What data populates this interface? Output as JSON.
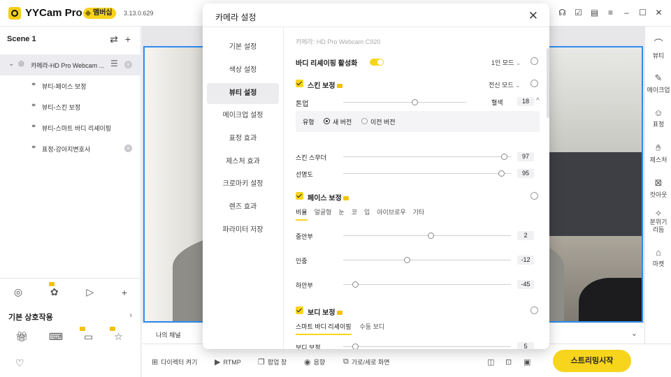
{
  "titlebar": {
    "app_name": "YYCam Pro",
    "member_badge": "멤버십",
    "version": "3.13.0.629",
    "icons": [
      "headset-icon",
      "feedback-icon",
      "doc-icon",
      "menu-icon",
      "minimize-icon",
      "maximize-icon",
      "close-icon"
    ]
  },
  "left_panel": {
    "scene_title": "Scene 1",
    "sources": [
      {
        "label": "카메라-HD Pro Webcam ...",
        "icon": "camera-icon"
      },
      {
        "label": "뷰티-페이스 보정",
        "icon": "link-icon"
      },
      {
        "label": "뷰티-스킨 보정",
        "icon": "link-icon"
      },
      {
        "label": "뷰티-스마트 바디 리셰이핑",
        "icon": "link-icon"
      },
      {
        "label": "표정-강아지변호사",
        "icon": "link-icon"
      }
    ],
    "interaction_title": "기본 상호작용"
  },
  "preview": {
    "channel_label": "나의 채널"
  },
  "toolbar": {
    "director": "다이렉터 켜기",
    "rtmp": "RTMP",
    "popup": "팝업 창",
    "audio": "음향",
    "orientation": "가로/세로 화면",
    "stream_button": "스트리밍시작"
  },
  "rail": [
    {
      "label": "뷰티",
      "icon": "beauty-icon"
    },
    {
      "label": "메이크업",
      "icon": "makeup-icon"
    },
    {
      "label": "표정",
      "icon": "face-icon"
    },
    {
      "label": "제스처",
      "icon": "gesture-icon"
    },
    {
      "label": "컷아웃",
      "icon": "cutout-icon"
    },
    {
      "label": "분위기 리듬",
      "icon": "sparkle-icon"
    },
    {
      "label": "마켓",
      "icon": "market-icon"
    }
  ],
  "modal": {
    "title": "카메라 설정",
    "nav": [
      "기본 설정",
      "색상 설정",
      "뷰티 설정",
      "메이크업 설정",
      "표정 효과",
      "제스처 효과",
      "크로마키 설정",
      "렌즈 효과",
      "파라미터 저장"
    ],
    "active_nav": "뷰티 설정",
    "camera_name": "카메라: HD Pro Webcam C920",
    "body_reshape": {
      "label": "바디 리셰이핑 활성화",
      "enabled": true,
      "mode": "1인 모드"
    },
    "skin": {
      "label": "스킨 보정",
      "mode": "전신 모드",
      "tone_label": "톤업",
      "tone_value": 0.6,
      "blood_label": "혈색",
      "blood_value": "18",
      "type_label": "유형",
      "type_new": "새 버전",
      "type_old": "이전 버전",
      "smoother_label": "스킨 스무더",
      "smoother_value": "97",
      "sharp_label": "선명도",
      "sharp_value": "95"
    },
    "face": {
      "label": "페이스 보정",
      "tabs": [
        "비율",
        "얼굴형",
        "눈",
        "코",
        "입",
        "아이브로우",
        "기타"
      ],
      "active_tab": "비율",
      "mid_label": "중안부",
      "mid_value": "2",
      "philtrum_label": "인중",
      "philtrum_value": "-12",
      "lower_label": "하안부",
      "lower_value": "-45"
    },
    "body": {
      "label": "보디 보정",
      "tabs": [
        "스마트 바디 리셰이핑",
        "수동 보디"
      ],
      "active_tab": "스마트 바디 리셰이핑",
      "row_label": "보디 보정",
      "row_value": "5"
    }
  },
  "colors": {
    "accent": "#f7d51c",
    "selection_border": "#2d8cf0"
  }
}
